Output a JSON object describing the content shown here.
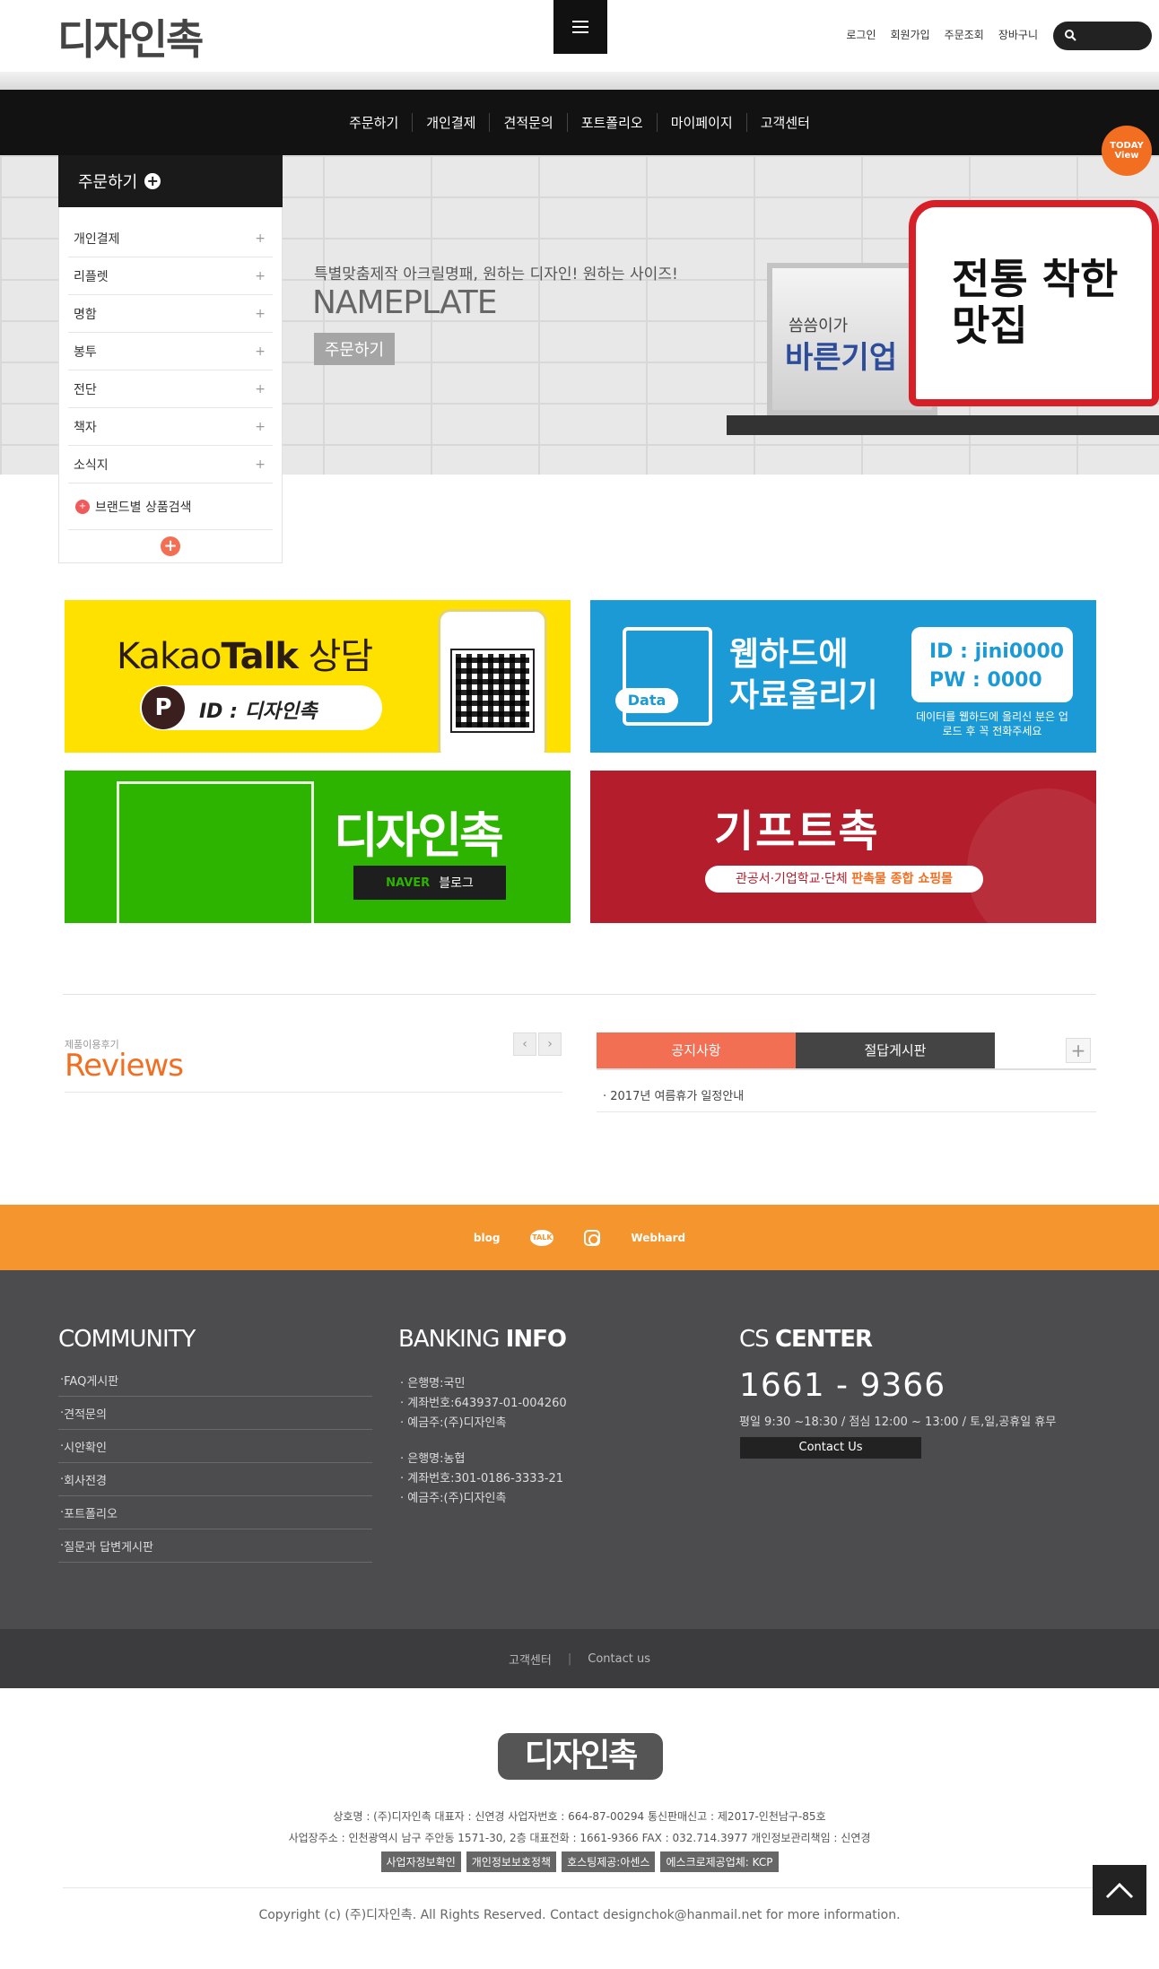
{
  "header": {
    "logo": "디자인촉",
    "top_links": [
      "로그인",
      "회원가입",
      "주문조회",
      "장바구니"
    ],
    "search_placeholder": ""
  },
  "gnb": [
    "주문하기",
    "개인결제",
    "견적문의",
    "포트폴리오",
    "마이페이지",
    "고객센터"
  ],
  "hero": {
    "subtitle": "특별맞춤제작 아크릴명패, 원하는 디자인! 원하는 사이즈!",
    "title": "NAMEPLATE",
    "button": "주문하기",
    "plate1_small": "씀씀이가",
    "plate1_big": "바른기업",
    "plate2_big": "전통 착한맛집",
    "today_view": "TODAY View"
  },
  "side_menu": {
    "title": "주문하기",
    "items": [
      "개인결제",
      "리플렛",
      "명함",
      "봉투",
      "전단",
      "책자",
      "소식지"
    ],
    "brand_search": "브랜드별 상품검색"
  },
  "banners": {
    "kakao": {
      "title_light": "Kakao",
      "title_bold": "Talk",
      "title_rest": " 상담",
      "p": "P",
      "id": "ID : 디자인촉"
    },
    "webhard": {
      "data_label": "Data",
      "title_line1": "웹하드에",
      "title_line2": "자료올리기",
      "id": "ID : jini0000",
      "pw": "PW : 0000",
      "note": "데이터를 웹하드에 올리신 분은 업로드 후 꼭 전화주세요"
    },
    "blog": {
      "logo": "디자인촉",
      "naver": "NAVER",
      "blog": "블로그"
    },
    "gift": {
      "logo": "기프트촉",
      "pill_prefix": "관공서·기업학교·단체 ",
      "pill_highlight": "판촉물 종합 쇼핑몰"
    }
  },
  "reviews": {
    "small": "제품이용후기",
    "title": "Reviews"
  },
  "notice": {
    "tab1": "공지사항",
    "tab2": "절답게시판",
    "items": [
      "2017년 여름휴가 일정안내"
    ]
  },
  "social": [
    "blog",
    "TALK",
    "",
    "Webhard"
  ],
  "footer": {
    "community_title": "COMMUNITY",
    "community_items": [
      "FAQ게시판",
      "견적문의",
      "시안확인",
      "회사전경",
      "포트폴리오",
      "질문과 답변게시판"
    ],
    "banking_title_light": "BANKING ",
    "banking_title_bold": "INFO",
    "bank1": [
      "은행명:국민",
      "계좌번호:643937-01-004260",
      "예금주:(주)디자인촉"
    ],
    "bank2": [
      "은행명:농협",
      "계좌번호:301-0186-3333-21",
      "예금주:(주)디자인촉"
    ],
    "cs_title_light": "CS ",
    "cs_title_bold": "CENTER",
    "cs_phone": "1661 - 9366",
    "cs_hours": "평일 9:30 ~18:30 / 점심 12:00 ~ 13:00 / 토,일,공휴일 휴무",
    "cs_button": "Contact Us",
    "bar_links": [
      "고객센터",
      "Contact us"
    ]
  },
  "company": {
    "logo": "디자인촉",
    "line1": "상호명 : (주)디자인촉     대표자 : 신연경     사업자번호 : 664-87-00294     통신판매신고 : 제2017-인천남구-85호",
    "line2": "사업장주소 : 인천광역시 남구 주안동 1571-30, 2층     대표전화 : 1661-9366     FAX : 032.714.3977     개인정보관리책임 : 신연경",
    "badges": [
      "사업자정보확인",
      "개인정보보호정책",
      "호스팅제공:아센스",
      "에스크로제공업체: KCP"
    ],
    "copyright": "Copyright (c) (주)디자인촉. All Rights Reserved. Contact designchok@hanmail.net for more information."
  }
}
